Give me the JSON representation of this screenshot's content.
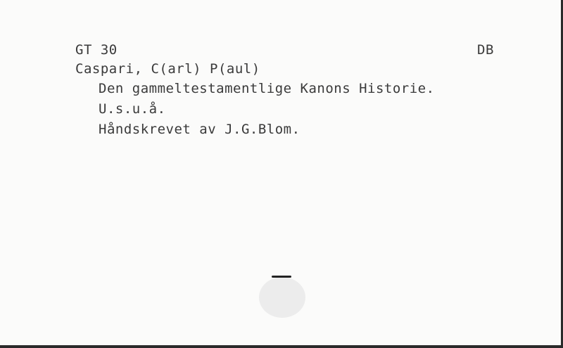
{
  "card": {
    "call_number": "GT 30",
    "location_code": "DB",
    "author": "Caspari, C(arl) P(aul)",
    "title": "Den gammeltestamentlige Kanons Historie.",
    "imprint": "U.s.u.å.",
    "note": "Håndskrevet av J.G.Blom."
  }
}
